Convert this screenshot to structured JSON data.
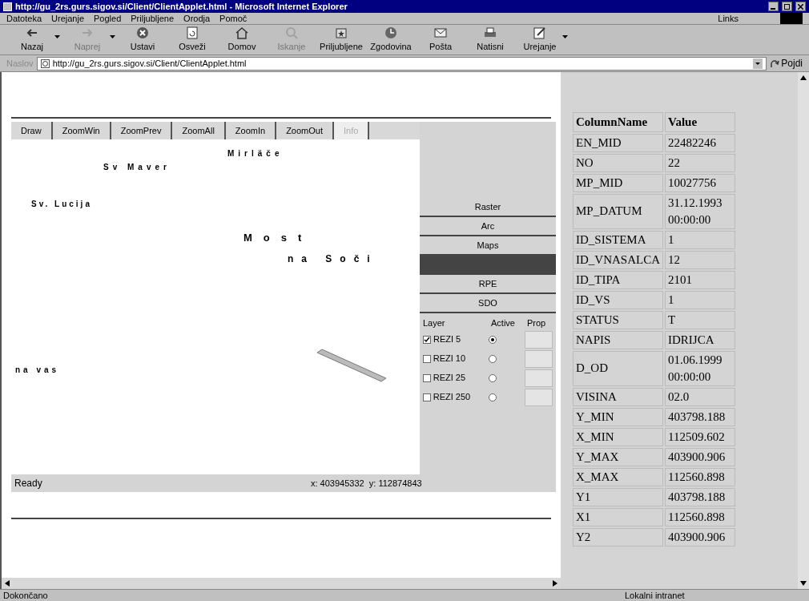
{
  "window": {
    "title": "http://gu_2rs.gurs.sigov.si/Client/ClientApplet.html - Microsoft Internet Explorer"
  },
  "menu": [
    "Datoteka",
    "Urejanje",
    "Pogled",
    "Priljubljene",
    "Orodja",
    "Pomoč"
  ],
  "links": "Links",
  "toolbar": [
    {
      "label": "Nazaj",
      "kind": "back",
      "disabled": false,
      "dropdown": true
    },
    {
      "label": "Naprej",
      "kind": "forward",
      "disabled": true,
      "dropdown": true
    },
    {
      "label": "Ustavi",
      "kind": "stop",
      "disabled": false,
      "dropdown": false
    },
    {
      "label": "Osveži",
      "kind": "refresh",
      "disabled": false,
      "dropdown": false
    },
    {
      "label": "Domov",
      "kind": "home",
      "disabled": false,
      "dropdown": false
    },
    {
      "label": "Iskanje",
      "kind": "search",
      "disabled": true,
      "dropdown": false
    },
    {
      "label": "Priljubljene",
      "kind": "favorites",
      "disabled": false,
      "dropdown": false
    },
    {
      "label": "Zgodovina",
      "kind": "history",
      "disabled": false,
      "dropdown": false
    },
    {
      "label": "Pošta",
      "kind": "mail",
      "disabled": false,
      "dropdown": false
    },
    {
      "label": "Natisni",
      "kind": "print",
      "disabled": false,
      "dropdown": false
    },
    {
      "label": "Urejanje",
      "kind": "edit",
      "disabled": false,
      "dropdown": true
    }
  ],
  "address": {
    "label": "Naslov",
    "value": "http://gu_2rs.gurs.sigov.si/Client/ClientApplet.html",
    "go": "Pojdi"
  },
  "applet": {
    "tools": [
      {
        "label": "Draw",
        "disabled": false
      },
      {
        "label": "ZoomWin",
        "disabled": false
      },
      {
        "label": "ZoomPrev",
        "disabled": false
      },
      {
        "label": "ZoomAll",
        "disabled": false
      },
      {
        "label": "ZoomIn",
        "disabled": false
      },
      {
        "label": "ZoomOut",
        "disabled": false
      },
      {
        "label": "Info",
        "disabled": true
      }
    ],
    "map_labels": [
      {
        "text": "Mirläče"
      },
      {
        "text": "Sv Maver"
      },
      {
        "text": "Sv. Lucija"
      },
      {
        "text": "Most"
      },
      {
        "text": "na Soči"
      },
      {
        "text": "na vas"
      }
    ],
    "themes": [
      {
        "label": "Raster",
        "selected": false
      },
      {
        "label": "Arc",
        "selected": false
      },
      {
        "label": "Maps",
        "selected": false
      },
      {
        "selected": true
      },
      {
        "label": "RPE",
        "selected": false
      },
      {
        "label": "SDO",
        "selected": false
      }
    ],
    "layer_columns": [
      "Layer",
      "Active",
      "Prop"
    ],
    "layers": [
      {
        "name": "REZI 5",
        "checked": true,
        "active": true
      },
      {
        "name": "REZI 10",
        "checked": false,
        "active": false
      },
      {
        "name": "REZI 25",
        "checked": false,
        "active": false
      },
      {
        "name": "REZI 250",
        "checked": false,
        "active": false
      }
    ],
    "status": "Ready",
    "coordinates": "x: 403945332  y: 112874843"
  },
  "table": {
    "columns": [
      "ColumnName",
      "Value"
    ],
    "rows": [
      [
        "EN_MID",
        "22482246"
      ],
      [
        "NO",
        "22"
      ],
      [
        "MP_MID",
        "10027756"
      ],
      [
        "MP_DATUM",
        "31.12.1993 00:00:00"
      ],
      [
        "ID_SISTEMA",
        "1"
      ],
      [
        "ID_VNASALCA",
        "12"
      ],
      [
        "ID_TIPA",
        "2101"
      ],
      [
        "ID_VS",
        "1"
      ],
      [
        "STATUS",
        "T"
      ],
      [
        "NAPIS",
        "IDRIJCA"
      ],
      [
        "D_OD",
        "01.06.1999 00:00:00"
      ],
      [
        "VISINA",
        "02.0"
      ],
      [
        "Y_MIN",
        "403798.188"
      ],
      [
        "X_MIN",
        "112509.602"
      ],
      [
        "Y_MAX",
        "403900.906"
      ],
      [
        "X_MAX",
        "112560.898"
      ],
      [
        "Y1",
        "403798.188"
      ],
      [
        "X1",
        "112560.898"
      ],
      [
        "Y2",
        "403900.906"
      ]
    ]
  },
  "status_bar": {
    "text": "Dokončano",
    "zone": "Lokalni intranet"
  }
}
